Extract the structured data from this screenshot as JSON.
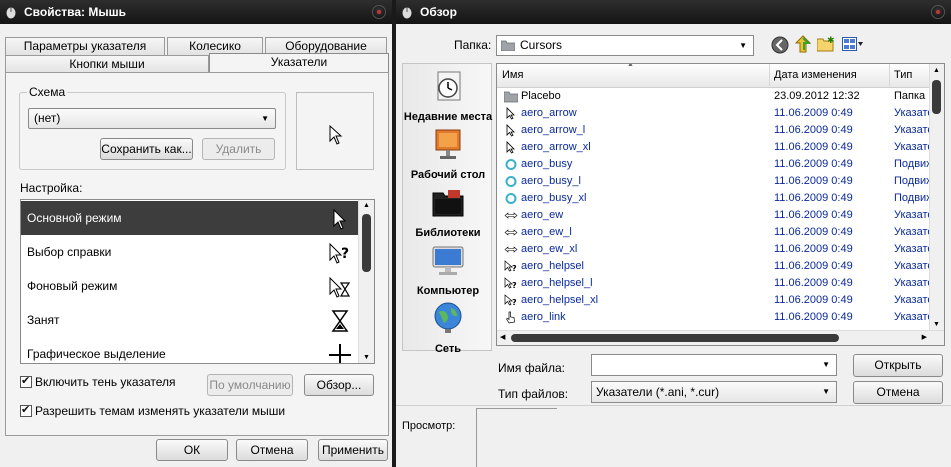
{
  "mouse_dialog": {
    "title": "Свойства: Мышь",
    "tabs_row1": [
      "Параметры указателя",
      "Колесико",
      "Оборудование"
    ],
    "tabs_row2": [
      "Кнопки мыши",
      "Указатели"
    ],
    "scheme": {
      "label": "Схема",
      "value": "(нет)",
      "save_label": "Сохранить как...",
      "delete_label": "Удалить"
    },
    "settings_label": "Настройка:",
    "cursor_list": [
      {
        "label": "Основной режим",
        "icon": "arrow-cursor-icon",
        "selected": true
      },
      {
        "label": "Выбор справки",
        "icon": "help-cursor-icon",
        "selected": false
      },
      {
        "label": "Фоновый режим",
        "icon": "working-in-background-cursor-icon",
        "selected": false
      },
      {
        "label": "Занят",
        "icon": "hourglass-cursor-icon",
        "selected": false
      },
      {
        "label": "Графическое выделение",
        "icon": "crosshair-cursor-icon",
        "selected": false
      }
    ],
    "shadow_checkbox": "Включить тень указателя",
    "default_button": "По умолчанию",
    "browse_button": "Обзор...",
    "themes_checkbox": "Разрешить темам изменять указатели мыши",
    "ok_button": "ОК",
    "cancel_button": "Отмена",
    "apply_button": "Применить"
  },
  "browse_dialog": {
    "title": "Обзор",
    "folder_label": "Папка:",
    "folder_value": "Cursors",
    "sidebar": [
      {
        "label": "Недавние места",
        "icon": "recent-places-icon"
      },
      {
        "label": "Рабочий стол",
        "icon": "desktop-icon"
      },
      {
        "label": "Библиотеки",
        "icon": "libraries-icon"
      },
      {
        "label": "Компьютер",
        "icon": "computer-icon"
      },
      {
        "label": "Сеть",
        "icon": "network-icon"
      }
    ],
    "columns": {
      "name": "Имя",
      "date": "Дата изменения",
      "type": "Тип"
    },
    "files": [
      {
        "name": "Placebo",
        "date": "23.09.2012 12:32",
        "type": "Папка",
        "icon": "folder-icon"
      },
      {
        "name": "aero_arrow",
        "date": "11.06.2009 0:49",
        "type": "Указатель",
        "icon": "arrow-cursor-icon"
      },
      {
        "name": "aero_arrow_l",
        "date": "11.06.2009 0:49",
        "type": "Указатель",
        "icon": "arrow-cursor-icon"
      },
      {
        "name": "aero_arrow_xl",
        "date": "11.06.2009 0:49",
        "type": "Указатель",
        "icon": "arrow-cursor-icon"
      },
      {
        "name": "aero_busy",
        "date": "11.06.2009 0:49",
        "type": "Подвижный",
        "icon": "busy-ring-icon"
      },
      {
        "name": "aero_busy_l",
        "date": "11.06.2009 0:49",
        "type": "Подвижный",
        "icon": "busy-ring-icon"
      },
      {
        "name": "aero_busy_xl",
        "date": "11.06.2009 0:49",
        "type": "Подвижный",
        "icon": "busy-ring-icon"
      },
      {
        "name": "aero_ew",
        "date": "11.06.2009 0:49",
        "type": "Указатель",
        "icon": "resize-ew-icon"
      },
      {
        "name": "aero_ew_l",
        "date": "11.06.2009 0:49",
        "type": "Указатель",
        "icon": "resize-ew-icon"
      },
      {
        "name": "aero_ew_xl",
        "date": "11.06.2009 0:49",
        "type": "Указатель",
        "icon": "resize-ew-icon"
      },
      {
        "name": "aero_helpsel",
        "date": "11.06.2009 0:49",
        "type": "Указатель",
        "icon": "help-cursor-icon"
      },
      {
        "name": "aero_helpsel_l",
        "date": "11.06.2009 0:49",
        "type": "Указатель",
        "icon": "help-cursor-icon"
      },
      {
        "name": "aero_helpsel_xl",
        "date": "11.06.2009 0:49",
        "type": "Указатель",
        "icon": "help-cursor-icon"
      },
      {
        "name": "aero_link",
        "date": "11.06.2009 0:49",
        "type": "Указатель",
        "icon": "hand-cursor-icon"
      }
    ],
    "filename_label": "Имя файла:",
    "filename_value": "",
    "filetype_label": "Тип файлов:",
    "filetype_value": "Указатели (*.ani, *.cur)",
    "open_button": "Открыть",
    "cancel_button": "Отмена",
    "preview_label": "Просмотр:"
  },
  "colors": {
    "titlebar": "#1c1c1c",
    "selected_row": "#3d3d3d",
    "file_text": "#0a2a9a"
  }
}
